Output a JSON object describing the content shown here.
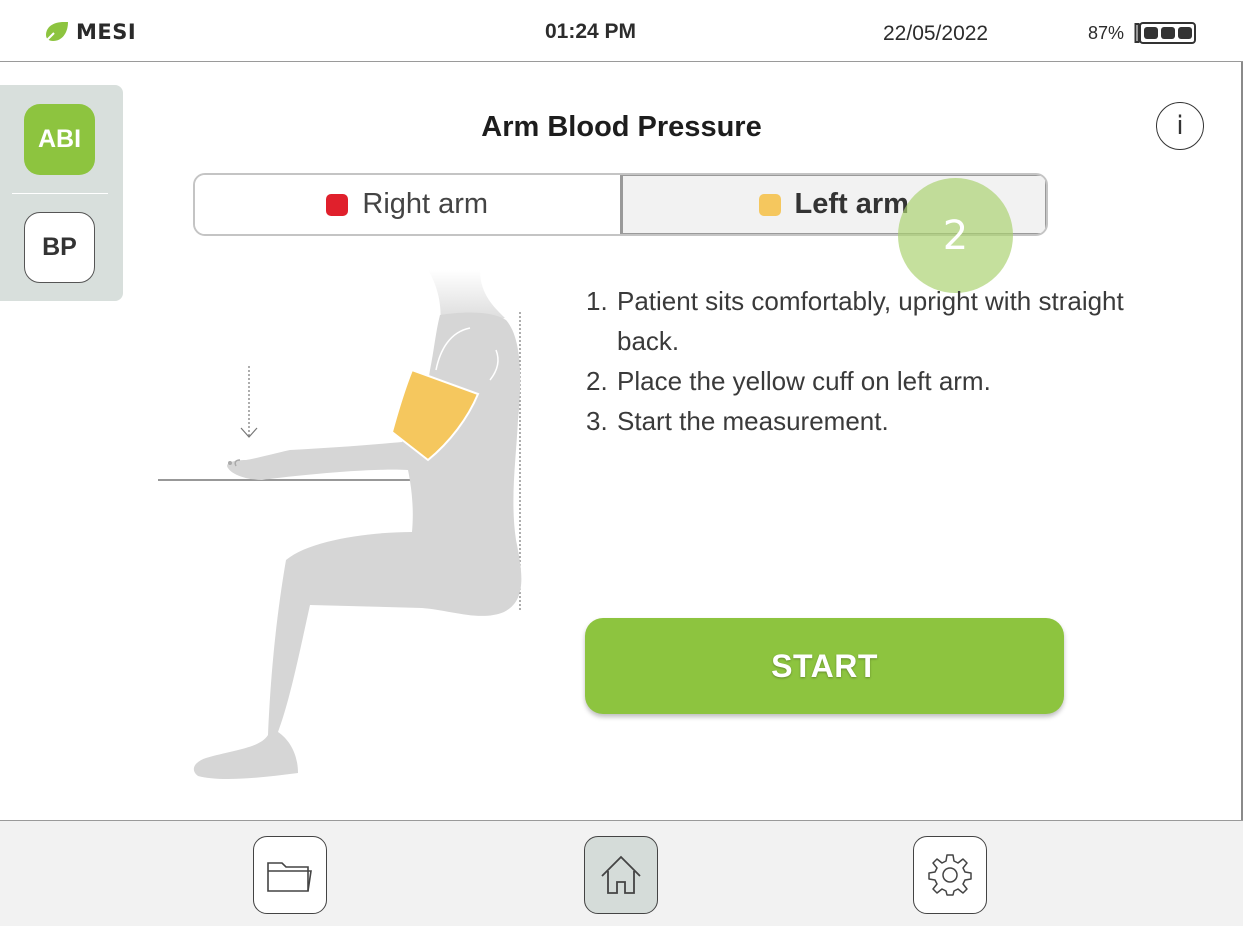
{
  "status_bar": {
    "brand": "MESI",
    "time": "01:24 PM",
    "date": "22/05/2022",
    "battery_percent": "87%",
    "battery_icon": "battery-icon"
  },
  "sidebar": {
    "items": [
      {
        "label": "ABI",
        "active": true
      },
      {
        "label": "BP",
        "active": false
      }
    ]
  },
  "main": {
    "title": "Arm Blood Pressure",
    "info_icon": "i",
    "tabs": [
      {
        "label": "Right arm",
        "color": "#e0202c",
        "selected": false
      },
      {
        "label": "Left arm",
        "color": "#f5c75e",
        "selected": true
      }
    ],
    "step_badge": "2",
    "instructions": [
      {
        "num": "1.",
        "text": "Patient sits comfortably, upright with straight back."
      },
      {
        "num": "2.",
        "text": "Place the yellow cuff on left arm."
      },
      {
        "num": "3.",
        "text": "Start the measurement."
      }
    ],
    "start_label": "START"
  },
  "bottom_nav": {
    "items": [
      {
        "icon": "folder-icon"
      },
      {
        "icon": "home-icon",
        "active": true
      },
      {
        "icon": "gear-icon"
      }
    ]
  },
  "colors": {
    "accent_green": "#8dc43f",
    "cuff_yellow": "#f5c75e",
    "right_arm_red": "#e0202c",
    "silhouette_gray": "#d6d6d6"
  }
}
